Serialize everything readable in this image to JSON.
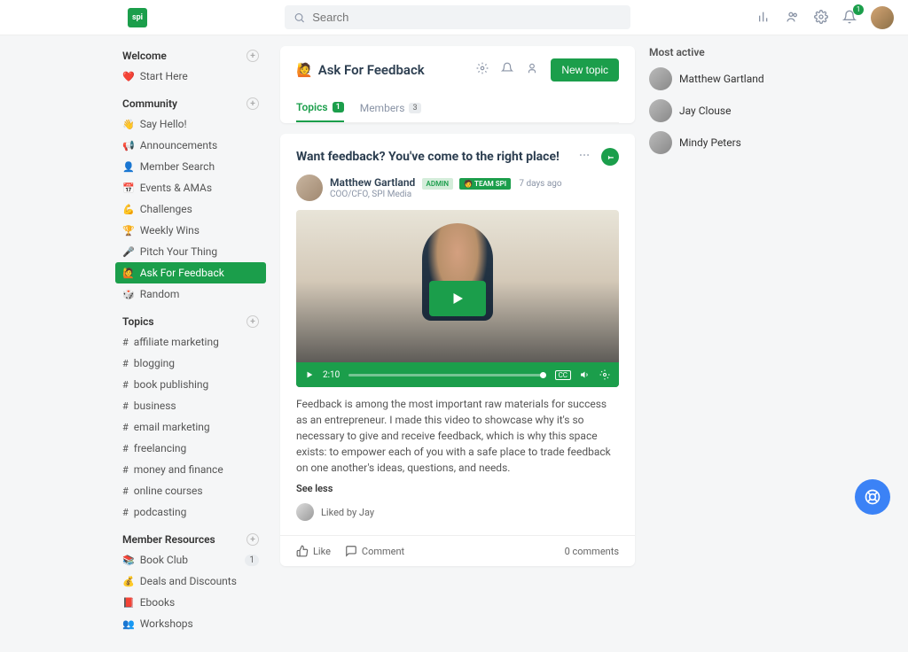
{
  "header": {
    "logo_text": "spi",
    "search_placeholder": "Search",
    "notification_count": "1"
  },
  "sidebar": {
    "sections": [
      {
        "title": "Welcome",
        "items": [
          {
            "emoji": "❤️",
            "label": "Start Here"
          }
        ]
      },
      {
        "title": "Community",
        "items": [
          {
            "emoji": "👋",
            "label": "Say Hello!"
          },
          {
            "emoji": "📢",
            "label": "Announcements"
          },
          {
            "emoji": "👤",
            "label": "Member Search"
          },
          {
            "emoji": "📅",
            "label": "Events & AMAs"
          },
          {
            "emoji": "💪",
            "label": "Challenges"
          },
          {
            "emoji": "🏆",
            "label": "Weekly Wins"
          },
          {
            "emoji": "🎤",
            "label": "Pitch Your Thing"
          },
          {
            "emoji": "🙋",
            "label": "Ask For Feedback",
            "active": true
          },
          {
            "emoji": "🎲",
            "label": "Random"
          }
        ]
      },
      {
        "title": "Topics",
        "items": [
          {
            "emoji": "#",
            "label": "affiliate marketing"
          },
          {
            "emoji": "#",
            "label": "blogging"
          },
          {
            "emoji": "#",
            "label": "book publishing"
          },
          {
            "emoji": "#",
            "label": "business"
          },
          {
            "emoji": "#",
            "label": "email marketing"
          },
          {
            "emoji": "#",
            "label": "freelancing"
          },
          {
            "emoji": "#",
            "label": "money and finance"
          },
          {
            "emoji": "#",
            "label": "online courses"
          },
          {
            "emoji": "#",
            "label": "podcasting"
          }
        ]
      },
      {
        "title": "Member Resources",
        "items": [
          {
            "emoji": "📚",
            "label": "Book Club",
            "count": "1"
          },
          {
            "emoji": "💰",
            "label": "Deals and Discounts"
          },
          {
            "emoji": "📕",
            "label": "Ebooks"
          },
          {
            "emoji": "👥",
            "label": "Workshops"
          }
        ]
      }
    ]
  },
  "space": {
    "emoji": "🙋",
    "title": "Ask For Feedback",
    "new_topic_label": "New topic",
    "tabs": [
      {
        "label": "Topics",
        "count": "1",
        "active": true
      },
      {
        "label": "Members",
        "count": "3"
      }
    ]
  },
  "post": {
    "title": "Want feedback? You've come to the right place!",
    "author_name": "Matthew Gartland",
    "author_role": "COO/CFO, SPI Media",
    "badge_admin": "ADMIN",
    "badge_team": "🧑 TEAM SPI",
    "timestamp": "7 days ago",
    "video_time": "2:10",
    "body": "Feedback is among the most important raw materials for success as an entrepreneur. I made this video to showcase why it's so necessary to give and receive feedback, which is why this space exists: to empower each of you with a safe place to trade feedback on one another's ideas, questions, and needs.",
    "see_less": "See less",
    "liked_by": "Liked by Jay",
    "like_label": "Like",
    "comment_label": "Comment",
    "comments_count": "0 comments"
  },
  "rightcol": {
    "title": "Most active",
    "users": [
      {
        "name": "Matthew Gartland"
      },
      {
        "name": "Jay Clouse"
      },
      {
        "name": "Mindy Peters"
      }
    ]
  }
}
